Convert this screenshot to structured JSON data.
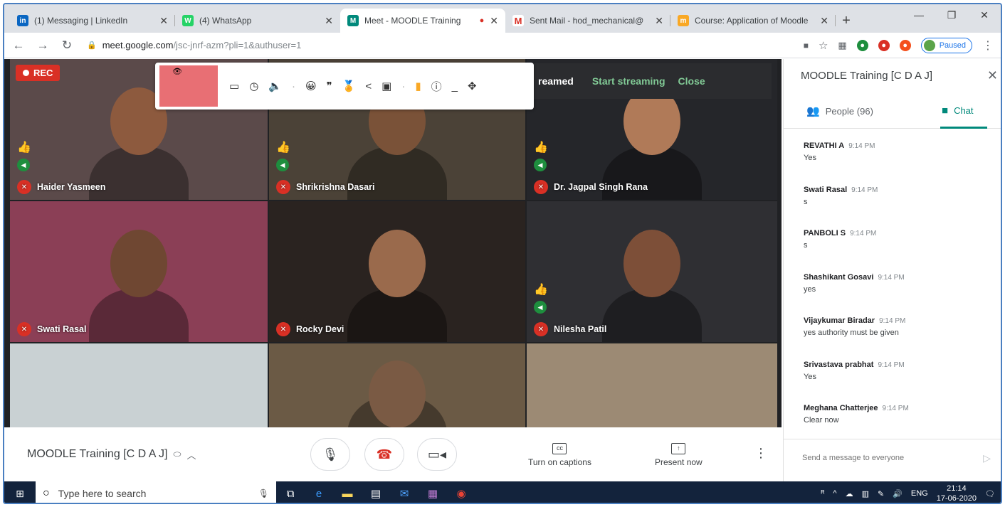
{
  "browser": {
    "tabs": [
      {
        "label": "(1) Messaging | LinkedIn",
        "color": "#0a66c2",
        "glyph": "in"
      },
      {
        "label": "(4) WhatsApp",
        "color": "#25d366",
        "glyph": "W"
      },
      {
        "label": "Meet - MOODLE Training",
        "color": "#00897b",
        "glyph": "M",
        "active": true
      },
      {
        "label": "Sent Mail - hod_mechanical@",
        "color": "#d93025",
        "glyph": "M"
      },
      {
        "label": "Course: Application of Moodle",
        "color": "#f9a825",
        "glyph": "m"
      }
    ],
    "url_host": "meet.google.com",
    "url_path": "/jsc-jnrf-azm?pli=1&authuser=1",
    "profile_status": "Paused"
  },
  "meet": {
    "rec_label": "REC",
    "stream_label": "reamed",
    "start_streaming": "Start streaming",
    "close": "Close",
    "tiles": [
      {
        "name": "Haider Yasmeen",
        "bg": "#5b4a4a",
        "skin": "#8d5a3e",
        "thumb": true
      },
      {
        "name": "Shrikrishna Dasari",
        "bg": "#4b4237",
        "skin": "#7a5238",
        "thumb": true
      },
      {
        "name": "Dr. Jagpal Singh Rana",
        "bg": "#25262a",
        "skin": "#b07a58",
        "thumb": true
      },
      {
        "name": "Swati Rasal",
        "bg": "#8b3f56",
        "skin": "#6f4732",
        "thumb": false
      },
      {
        "name": "Rocky Devi",
        "bg": "#2a2320",
        "skin": "#9a6a4c",
        "thumb": false
      },
      {
        "name": "Nilesha Patil",
        "bg": "#2f2f33",
        "skin": "#7d4f38",
        "thumb": true
      },
      {
        "name": "",
        "bg": "#c9d1d3",
        "skin": "",
        "thumb": false
      },
      {
        "name": "",
        "bg": "#6b5a45",
        "skin": "#7a5a44",
        "thumb": false
      },
      {
        "name": "",
        "bg": "#9c8a74",
        "skin": "",
        "thumb": false
      }
    ],
    "meeting_title": "MOODLE Training [C D A J]",
    "captions_label": "Turn on captions",
    "present_label": "Present now"
  },
  "panel": {
    "title": "MOODLE Training [C D A J]",
    "people_tab": "People (96)",
    "chat_tab": "Chat",
    "messages": [
      {
        "sender": "REVATHI A",
        "time": "9:14 PM",
        "text": "Yes"
      },
      {
        "sender": "Swati Rasal",
        "time": "9:14 PM",
        "text": "s"
      },
      {
        "sender": "PANBOLI S",
        "time": "9:14 PM",
        "text": "s"
      },
      {
        "sender": "Shashikant Gosavi",
        "time": "9:14 PM",
        "text": "yes"
      },
      {
        "sender": "Vijaykumar Biradar",
        "time": "9:14 PM",
        "text": "yes authority must be given"
      },
      {
        "sender": "Srivastava prabhat",
        "time": "9:14 PM",
        "text": "Yes"
      },
      {
        "sender": "Meghana Chatterjee",
        "time": "9:14 PM",
        "text": "Clear now"
      }
    ],
    "input_placeholder": "Send a message to everyone"
  },
  "taskbar": {
    "search_placeholder": "Type here to search",
    "language": "ENG",
    "time": "21:14",
    "date": "17-06-2020"
  }
}
